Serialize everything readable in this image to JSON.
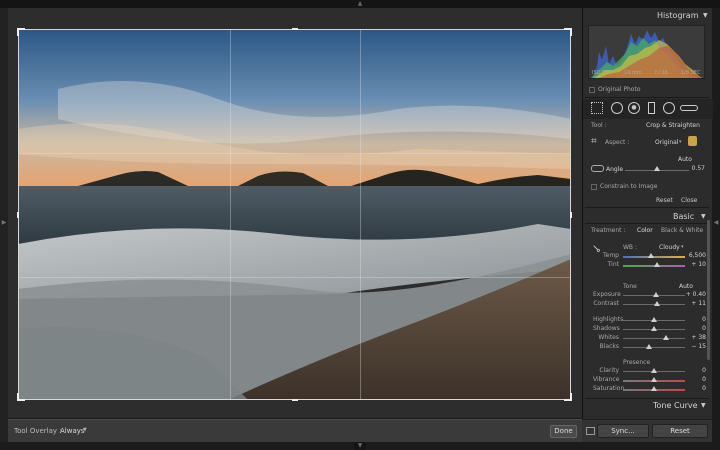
{
  "toolbar": {
    "overlay_label": "Tool Overlay :",
    "overlay_value": "Always",
    "done": "Done"
  },
  "histogram": {
    "title": "Histogram",
    "iso": "ISO 50",
    "focal": "14 mm",
    "aperture": "f / 16",
    "shutter": "1/8 SEC",
    "original_photo": "Original Photo"
  },
  "tool": {
    "label": "Tool :",
    "name": "Crop & Straighten",
    "aspect_label": "Aspect :",
    "aspect_value": "Original",
    "auto": "Auto",
    "angle_label": "Angle",
    "angle_value": "0.57",
    "angle": 0.57,
    "constrain": "Constrain to Image",
    "reset": "Reset",
    "close": "Close"
  },
  "basic": {
    "title": "Basic",
    "treatment_label": "Treatment :",
    "color": "Color",
    "bw": "Black & White",
    "wb_label": "WB :",
    "wb_value": "Cloudy",
    "temp_label": "Temp",
    "temp_value": "6,500",
    "tint_label": "Tint",
    "tint_value": "+ 10",
    "tone_label": "Tone",
    "tone_auto": "Auto",
    "exposure_label": "Exposure",
    "exposure_value": "+ 0.40",
    "contrast_label": "Contrast",
    "contrast_value": "+ 11",
    "highlights_label": "Highlights",
    "highlights_value": "0",
    "shadows_label": "Shadows",
    "shadows_value": "0",
    "whites_label": "Whites",
    "whites_value": "+ 38",
    "blacks_label": "Blacks",
    "blacks_value": "− 15",
    "presence_label": "Presence",
    "clarity_label": "Clarity",
    "clarity_value": "0",
    "vibrance_label": "Vibrance",
    "vibrance_value": "0",
    "saturation_label": "Saturation",
    "saturation_value": "0"
  },
  "tone_curve": {
    "title": "Tone Curve"
  },
  "bottom": {
    "sync": "Sync...",
    "reset": "Reset"
  },
  "icons": {
    "collapse": "triangle-down-icon",
    "crop": "crop-icon",
    "lock": "lock-icon",
    "eyedropper": "eyedropper-icon",
    "level": "level-icon"
  }
}
